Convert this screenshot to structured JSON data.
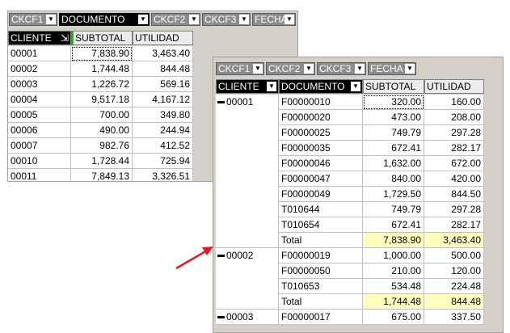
{
  "back": {
    "fields": [
      "CKCF1",
      "DOCUMENTO",
      "CKCF2",
      "CKCF3",
      "FECHA"
    ],
    "headers": [
      "CLIENTE",
      "SUBTOTAL",
      "UTILIDAD"
    ],
    "rows": [
      {
        "cliente": "00001",
        "subtotal": "7,838.90",
        "utilidad": "3,463.40"
      },
      {
        "cliente": "00002",
        "subtotal": "1,744.48",
        "utilidad": "844.48"
      },
      {
        "cliente": "00003",
        "subtotal": "1,226.72",
        "utilidad": "569.16"
      },
      {
        "cliente": "00004",
        "subtotal": "9,517.18",
        "utilidad": "4,167.12"
      },
      {
        "cliente": "00005",
        "subtotal": "700.00",
        "utilidad": "349.80"
      },
      {
        "cliente": "00006",
        "subtotal": "490.00",
        "utilidad": "244.94"
      },
      {
        "cliente": "00007",
        "subtotal": "982.76",
        "utilidad": "412.52"
      },
      {
        "cliente": "00010",
        "subtotal": "1,728.44",
        "utilidad": "725.94"
      },
      {
        "cliente": "00011",
        "subtotal": "7,849.13",
        "utilidad": "3,326.51"
      }
    ]
  },
  "front": {
    "fields": [
      "CKCF1",
      "CKCF2",
      "CKCF3",
      "FECHA"
    ],
    "headers": [
      "CLIENTE",
      "DOCUMENTO",
      "SUBTOTAL",
      "UTILIDAD"
    ],
    "groups": [
      {
        "cliente": "00001",
        "rows": [
          {
            "doc": "F00000010",
            "subtotal": "320.00",
            "utilidad": "160.00"
          },
          {
            "doc": "F00000020",
            "subtotal": "473.00",
            "utilidad": "208.00"
          },
          {
            "doc": "F00000025",
            "subtotal": "749.79",
            "utilidad": "297.28"
          },
          {
            "doc": "F00000035",
            "subtotal": "672.41",
            "utilidad": "282.17"
          },
          {
            "doc": "F00000046",
            "subtotal": "1,632.00",
            "utilidad": "672.00"
          },
          {
            "doc": "F00000047",
            "subtotal": "840.00",
            "utilidad": "420.00"
          },
          {
            "doc": "F00000049",
            "subtotal": "1,729.50",
            "utilidad": "844.50"
          },
          {
            "doc": "T010644",
            "subtotal": "749.79",
            "utilidad": "297.28"
          },
          {
            "doc": "T010654",
            "subtotal": "672.41",
            "utilidad": "282.17"
          },
          {
            "doc": "Total",
            "subtotal": "7,838.90",
            "utilidad": "3,463.40",
            "total": true
          }
        ]
      },
      {
        "cliente": "00002",
        "rows": [
          {
            "doc": "F00000019",
            "subtotal": "1,000.00",
            "utilidad": "500.00"
          },
          {
            "doc": "F00000050",
            "subtotal": "210.00",
            "utilidad": "120.00"
          },
          {
            "doc": "T010653",
            "subtotal": "534.48",
            "utilidad": "224.48"
          },
          {
            "doc": "Total",
            "subtotal": "1,744.48",
            "utilidad": "844.48",
            "total": true
          }
        ]
      },
      {
        "cliente": "00003",
        "rows": [
          {
            "doc": "F00000017",
            "subtotal": "675.00",
            "utilidad": "337.50"
          }
        ]
      }
    ]
  },
  "colors": {
    "arrow": "#e8191c",
    "total_bg": "#ffffc0",
    "grid_bg": "#d4d0c8"
  }
}
